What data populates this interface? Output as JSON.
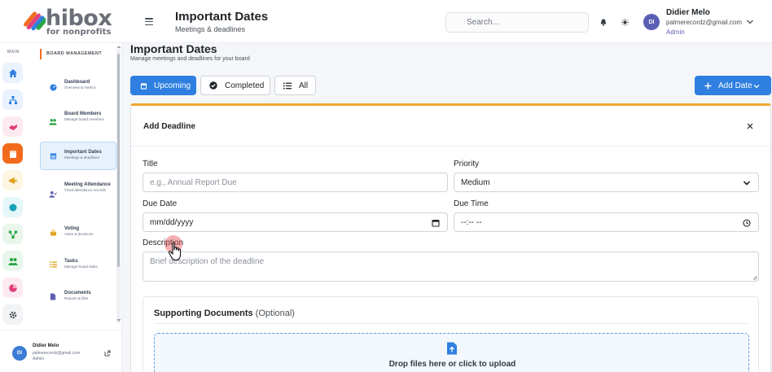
{
  "brand": {
    "name": "hibox",
    "tagline": "for nonprofits"
  },
  "rail": {
    "label": "MAIN",
    "buttons": [
      {
        "icon": "home-icon",
        "color": "#2f7fe0",
        "bg": "#eaf2fd",
        "active": false
      },
      {
        "icon": "sitemap-icon",
        "color": "#2f7fe0",
        "bg": "#eaf2fd",
        "active": false
      },
      {
        "icon": "handshake-icon",
        "color": "#e0407b",
        "bg": "#fdeaf1",
        "active": false
      },
      {
        "icon": "calendar-icon",
        "color": "#ffffff",
        "bg": "#f26b1d",
        "active": true
      },
      {
        "icon": "megaphone-icon",
        "color": "#e0a21d",
        "bg": "#fdf6e3",
        "active": false
      },
      {
        "icon": "circle-icon",
        "color": "#17a2b8",
        "bg": "#e6f7fa",
        "active": false
      },
      {
        "icon": "network-icon",
        "color": "#28a745",
        "bg": "#e8f6ec",
        "active": false
      },
      {
        "icon": "users-icon",
        "color": "#28a745",
        "bg": "#e8f6ec",
        "active": false
      },
      {
        "icon": "pie-chart-icon",
        "color": "#e0407b",
        "bg": "#fdeaf1",
        "active": false
      },
      {
        "icon": "gear-icon",
        "color": "#495057",
        "bg": "#f1f3f5",
        "active": false
      }
    ]
  },
  "sidebar": {
    "heading": "BOARD MANAGEMENT",
    "items": [
      {
        "title": "Dashboard",
        "subtitle": "Overview & metrics",
        "icon": "gauge-icon"
      },
      {
        "title": "Board Members",
        "subtitle": "Manage board members",
        "icon": "users-icon"
      },
      {
        "title": "Important Dates",
        "subtitle": "Meetings & deadlines",
        "icon": "calendar-icon"
      },
      {
        "title": "Meeting Attendance",
        "subtitle": "Track attendance records",
        "icon": "user-check-icon"
      },
      {
        "title": "Voting",
        "subtitle": "Votes & decisions",
        "icon": "ballot-icon"
      },
      {
        "title": "Tasks",
        "subtitle": "Manage board tasks",
        "icon": "tasks-icon"
      },
      {
        "title": "Documents",
        "subtitle": "Reports & files",
        "icon": "file-icon"
      }
    ],
    "user": {
      "initials": "DI",
      "name": "Didier Melo",
      "email": "palmerecordz@gmail.com",
      "role": "Admin"
    }
  },
  "header": {
    "title": "Important Dates",
    "subtitle": "Meetings & deadlines",
    "search_placeholder": "Search...",
    "user": {
      "initials": "DI",
      "name": "Didier Melo",
      "email": "palmerecordz@gmail.com",
      "role": "Admin"
    }
  },
  "main": {
    "title": "Important Dates",
    "subtitle": "Manage meetings and deadlines for your board",
    "filters": {
      "upcoming": "Upcoming",
      "completed": "Completed",
      "all": "All"
    },
    "add_button": "Add Date"
  },
  "form": {
    "title": "Add Deadline",
    "title_label": "Title",
    "title_placeholder": "e.g., Annual Report Due",
    "priority_label": "Priority",
    "priority_value": "Medium",
    "due_date_label": "Due Date",
    "due_date_placeholder": "mm/dd/yyyy",
    "due_time_label": "Due Time",
    "due_time_placeholder": "--:-- --",
    "description_label": "Description",
    "description_placeholder": "Brief description of the deadline",
    "docs_title": "Supporting Documents",
    "docs_optional": "(Optional)",
    "dropzone_text": "Drop files here or click to upload"
  },
  "colors": {
    "primary": "#2f7fe0",
    "brand_orange": "#f26b1d",
    "card_accent": "#f0a530"
  }
}
